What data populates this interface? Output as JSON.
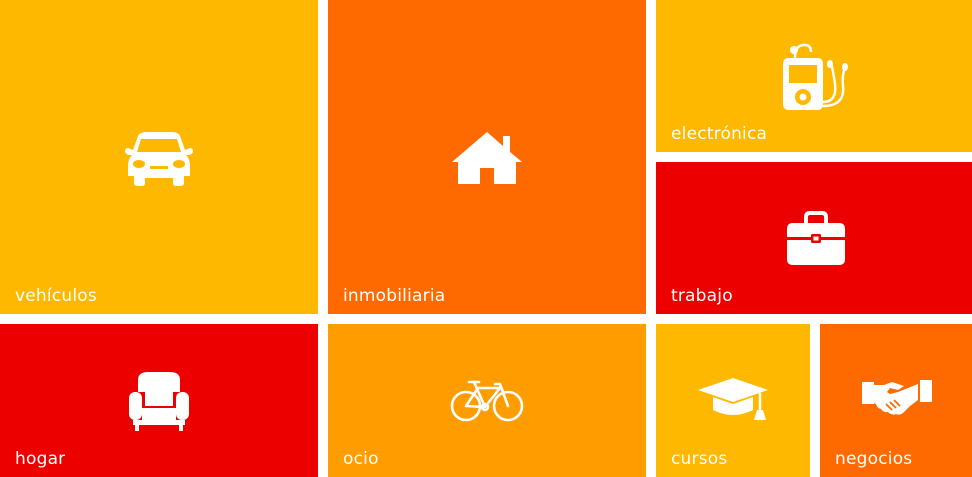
{
  "tiles": {
    "vehiculos": {
      "label": "vehículos",
      "color": "#FFB800",
      "icon": "car-icon"
    },
    "inmobiliaria": {
      "label": "inmobiliaria",
      "color": "#FF6A00",
      "icon": "house-icon"
    },
    "electronica": {
      "label": "electrónica",
      "color": "#FFB800",
      "icon": "mp3-player-icon"
    },
    "trabajo": {
      "label": "trabajo",
      "color": "#EC0000",
      "icon": "briefcase-icon"
    },
    "hogar": {
      "label": "hogar",
      "color": "#EC0000",
      "icon": "armchair-icon"
    },
    "ocio": {
      "label": "ocio",
      "color": "#FF9C00",
      "icon": "bicycle-icon"
    },
    "cursos": {
      "label": "cursos",
      "color": "#FFB800",
      "icon": "graduation-cap-icon"
    },
    "negocios": {
      "label": "negocios",
      "color": "#FF6A00",
      "icon": "handshake-icon"
    }
  }
}
